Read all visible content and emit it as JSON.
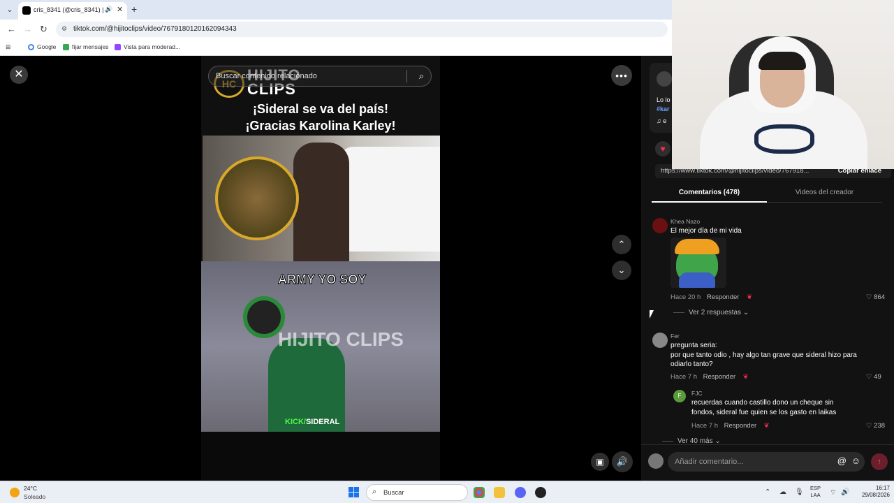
{
  "browser": {
    "tab_title": "cris_8341 (@cris_8341) | Tik",
    "url": "tiktok.com/@hijitoclips/video/7679180120162094343",
    "bookmarks": [
      "Google",
      "fijar mensajes",
      "Vista para moderad..."
    ]
  },
  "video": {
    "search_placeholder": "Buscar contenido relacionado",
    "logo_text": "HIJITO\nCLIPS",
    "logo_mark": "HC",
    "title_line1": "¡Sideral se va del país!",
    "title_line2": "¡Gracias Karolina Karley!",
    "frame2_text": "ARMY YO SOY",
    "watermark": "HIJITO CLIPS",
    "kick_prefix": "KICK/",
    "kick_name": "SIDERAL"
  },
  "panel": {
    "desc_line1": "Lo lo",
    "desc_tag": "#kar",
    "desc_music": "♫ e",
    "share_url": "https://www.tiktok.com/@hijitoclips/video/767918...",
    "copy_link": "Copiar enlace",
    "tab_comments": "Comentarios (478)",
    "tab_videos": "Videos del creador",
    "comments": [
      {
        "name": "Khea Nazo",
        "text": "El mejor día de mi vida",
        "time": "Hace 20 h",
        "reply": "Responder",
        "likes": "864",
        "see_replies": "Ver 2 respuestas ⌄"
      },
      {
        "name": "Fer",
        "text": "pregunta seria:\npor que tanto odio , hay algo tan grave que sideral hizo para odiarlo tanto?",
        "time": "Hace 7 h",
        "reply": "Responder",
        "likes": "49"
      },
      {
        "name": "FJC",
        "text": "recuerdas cuando castillo dono un cheque sin fondos, sideral fue quien se los gasto en laikas",
        "time": "Hace 7 h",
        "reply": "Responder",
        "likes": "238",
        "see_more": "Ver 40 más ⌄"
      }
    ],
    "comment_placeholder": "Añadir comentario..."
  },
  "taskbar": {
    "temp": "24°C",
    "weather": "Soleado",
    "search": "Buscar",
    "lang1": "ESP",
    "lang2": "LAA",
    "time": "16:17",
    "date": "29/08/2026"
  },
  "colors": {
    "accent": "#fe2c55",
    "brand_gold": "#d8a92a",
    "kick_green": "#4cfa4c"
  }
}
